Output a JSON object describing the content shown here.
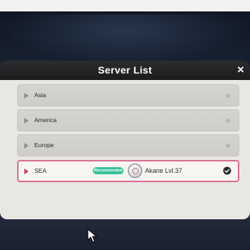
{
  "dialog": {
    "title": "Server List",
    "close_icon": "close-icon"
  },
  "servers": [
    {
      "name": "Asia",
      "selected": false
    },
    {
      "name": "America",
      "selected": false
    },
    {
      "name": "Europe",
      "selected": false
    },
    {
      "name": "SEA",
      "selected": true,
      "badge": "Recommended",
      "character": {
        "name": "Akane",
        "level": "Lvl.37"
      }
    }
  ],
  "colors": {
    "selected_border": "#d96b93",
    "badge_green": "#39c19a",
    "panel_bg": "#e9e7e2",
    "header_bg": "#1c1c1e"
  },
  "icons": {
    "flag": "flag-icon",
    "status": "status-dot-icon",
    "selected_check": "check-icon",
    "cursor": "cursor-icon"
  }
}
